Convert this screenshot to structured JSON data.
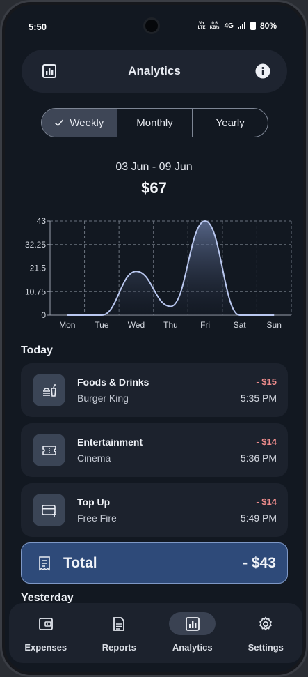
{
  "status": {
    "time": "5:50",
    "volte": "Vo LTE",
    "speed": "0.6 KB/s",
    "network": "4G",
    "battery": "80%"
  },
  "header": {
    "title": "Analytics",
    "left_icon": "bar-chart-icon",
    "right_icon": "info-icon"
  },
  "tabs": [
    {
      "label": "Weekly",
      "active": true
    },
    {
      "label": "Monthly",
      "active": false
    },
    {
      "label": "Yearly",
      "active": false
    }
  ],
  "period": {
    "range": "03 Jun - 09 Jun",
    "total": "$67"
  },
  "chart_data": {
    "type": "area",
    "categories": [
      "Mon",
      "Tue",
      "Wed",
      "Thu",
      "Fri",
      "Sat",
      "Sun"
    ],
    "values": [
      0,
      0,
      20,
      4,
      43,
      0,
      0
    ],
    "y_ticks": [
      "0",
      "10.75",
      "21.5",
      "32.25",
      "43"
    ],
    "ylim": [
      0,
      43
    ],
    "grid": true,
    "line_color": "#b9c7ef"
  },
  "today": {
    "label": "Today",
    "items": [
      {
        "icon": "food-drink-icon",
        "category": "Foods & Drinks",
        "merchant": "Burger King",
        "amount": "- $15",
        "time": "5:35 PM"
      },
      {
        "icon": "ticket-icon",
        "category": "Entertainment",
        "merchant": "Cinema",
        "amount": "- $14",
        "time": "5:36 PM"
      },
      {
        "icon": "credit-card-add-icon",
        "category": "Top Up",
        "merchant": "Free Fire",
        "amount": "- $14",
        "time": "5:49 PM"
      }
    ]
  },
  "total": {
    "label": "Total",
    "value": "- $43"
  },
  "yesterday": {
    "label": "Yesterday"
  },
  "nav": [
    {
      "label": "Expenses",
      "icon": "wallet-icon",
      "active": false
    },
    {
      "label": "Reports",
      "icon": "document-icon",
      "active": false
    },
    {
      "label": "Analytics",
      "icon": "bar-chart-icon",
      "active": true
    },
    {
      "label": "Settings",
      "icon": "gear-icon",
      "active": false
    }
  ],
  "colors": {
    "background": "#121821",
    "card": "#1c222d",
    "accent": "#2e4a79",
    "negative": "#ef8d8d"
  }
}
